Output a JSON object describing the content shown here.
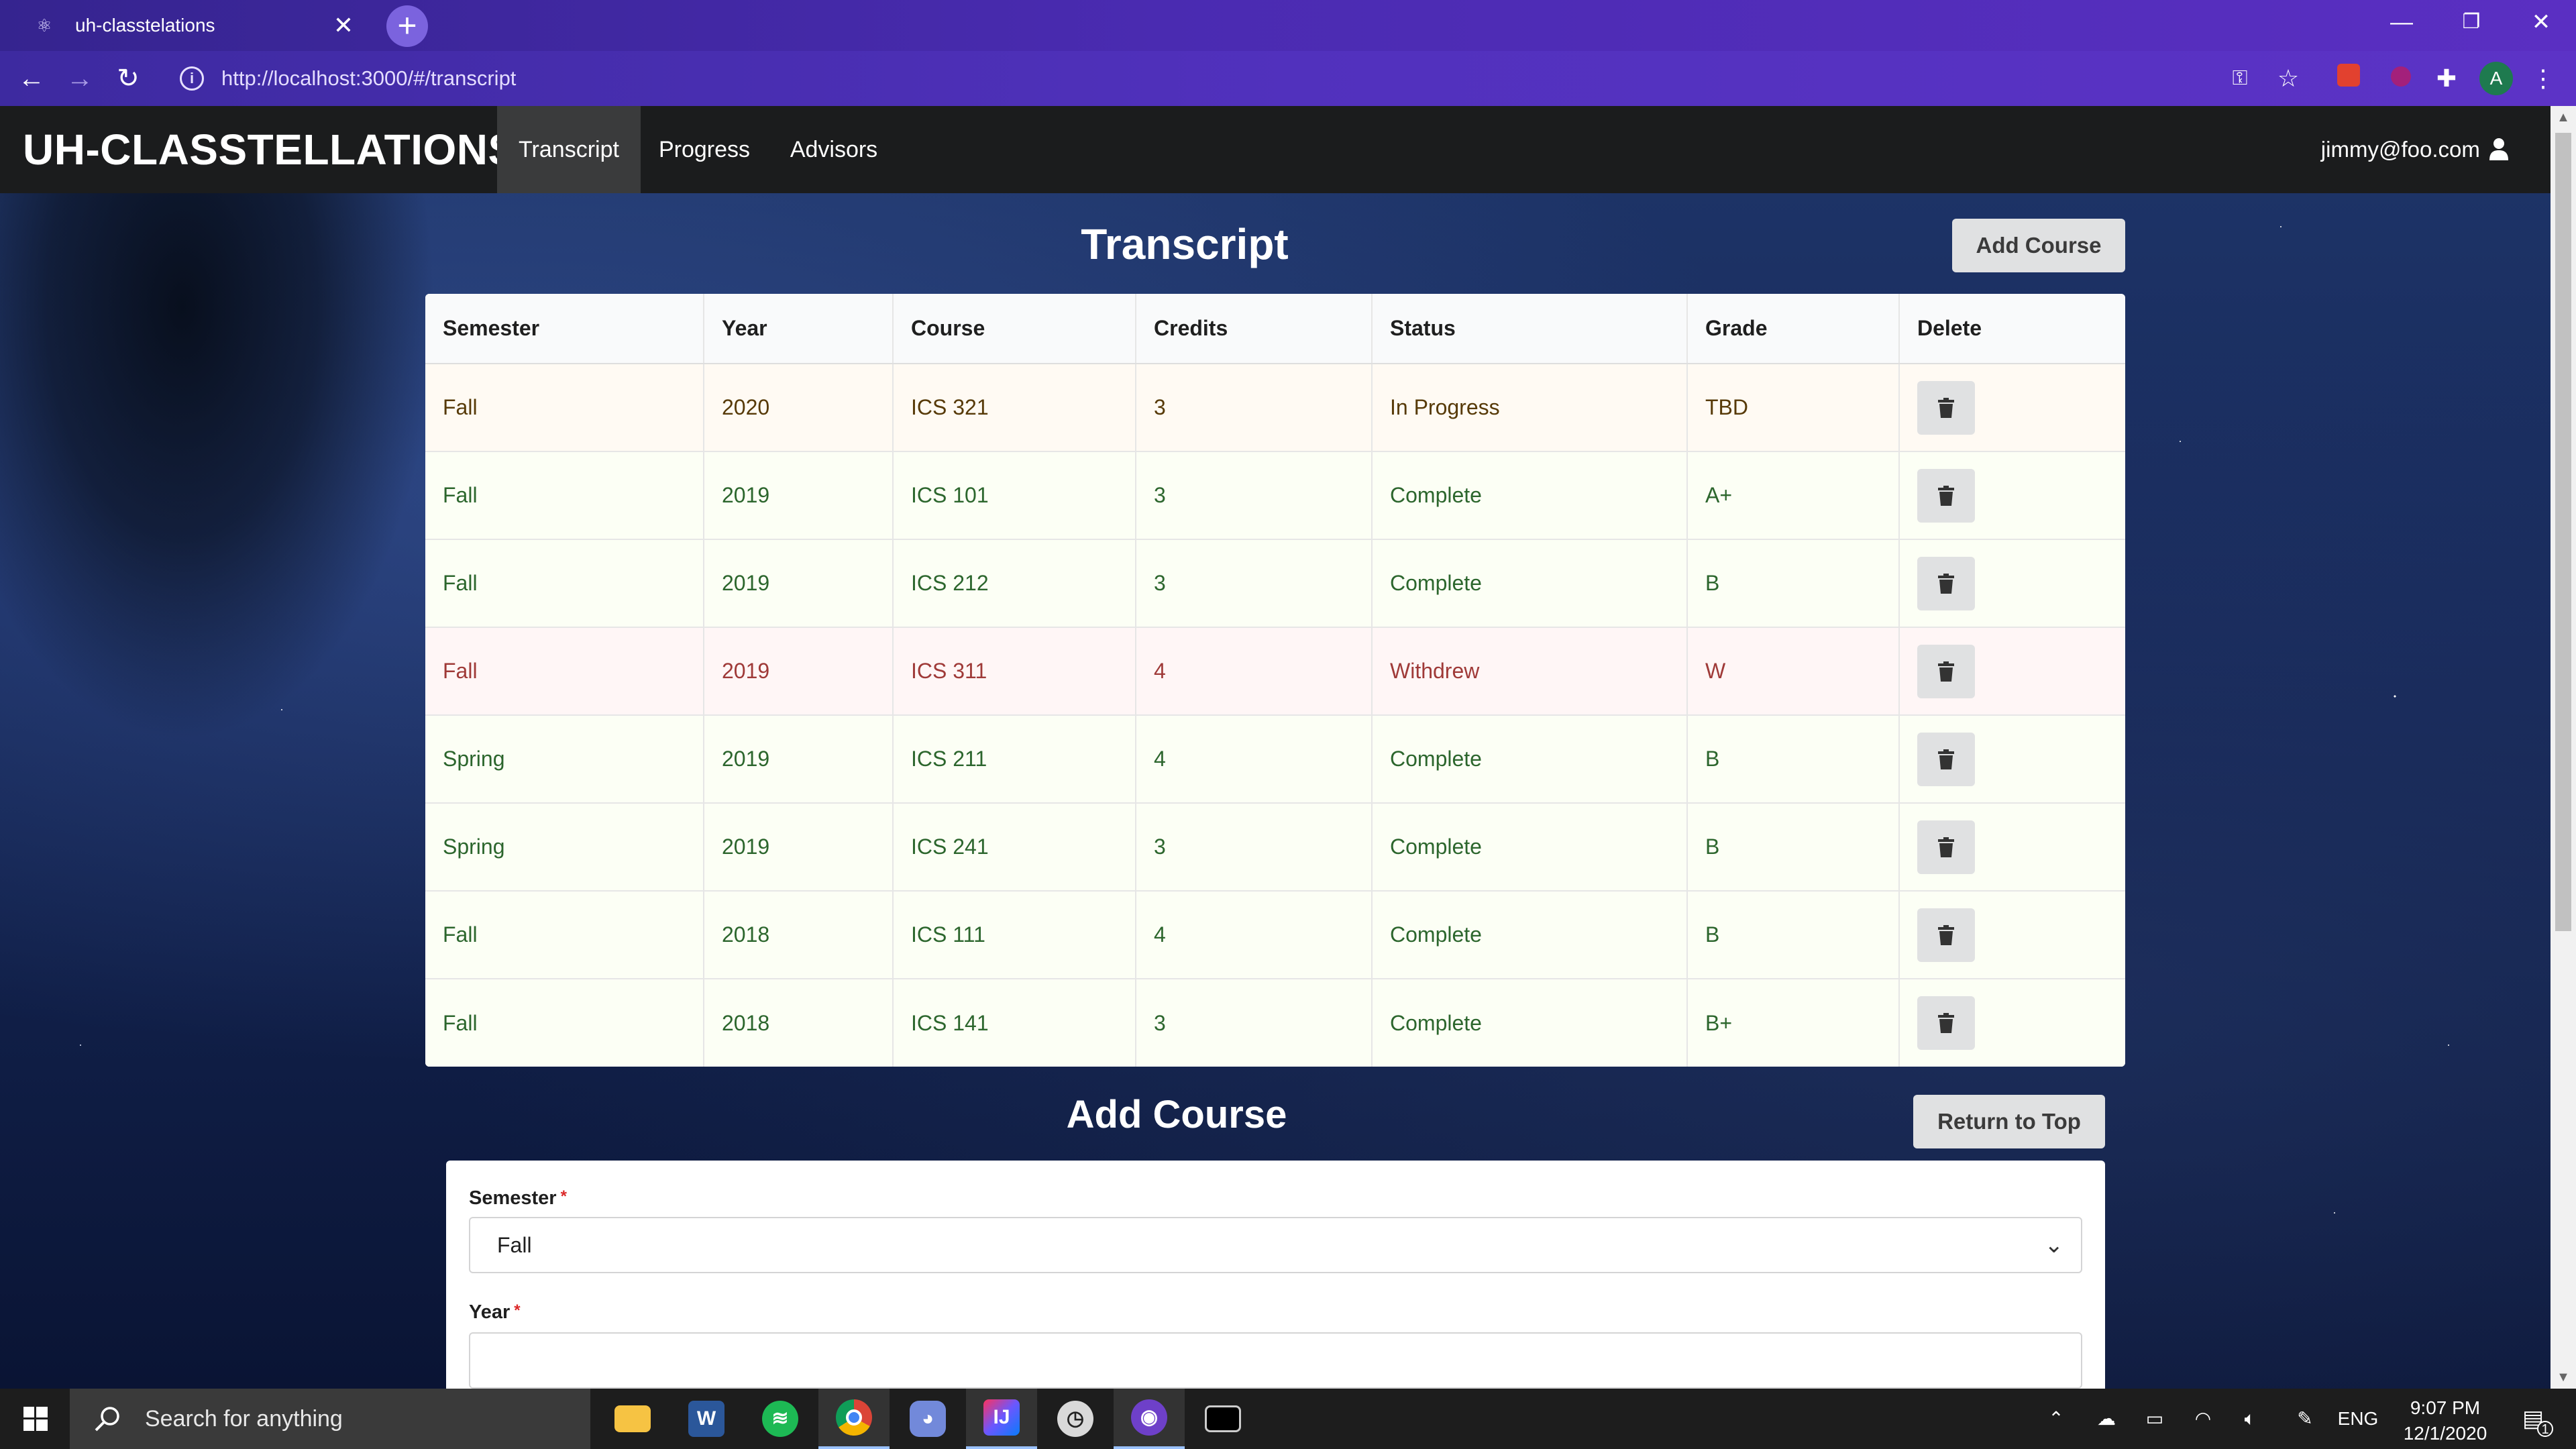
{
  "browser": {
    "tab_title": "uh-classtelations",
    "tab_close": "✕",
    "new_tab": "+",
    "url": "http://localhost:3000/#/transcript",
    "window_controls": {
      "minimize": "—",
      "restore": "❐",
      "close": "✕"
    },
    "nav": {
      "back": "←",
      "forward": "→",
      "reload": "↻"
    },
    "info_icon": "i",
    "profile_initial": "A"
  },
  "app": {
    "brand": "UH-CLASSTELLATIONS",
    "nav": [
      {
        "label": "Transcript",
        "active": true
      },
      {
        "label": "Progress",
        "active": false
      },
      {
        "label": "Advisors",
        "active": false
      }
    ],
    "user": "jimmy@foo.com"
  },
  "transcript": {
    "title": "Transcript",
    "add_course_button": "Add Course",
    "columns": [
      "Semester",
      "Year",
      "Course",
      "Credits",
      "Status",
      "Grade",
      "Delete"
    ],
    "rows": [
      {
        "semester": "Fall",
        "year": "2020",
        "course": "ICS 321",
        "credits": "3",
        "status": "In Progress",
        "grade": "TBD",
        "state": "warning"
      },
      {
        "semester": "Fall",
        "year": "2019",
        "course": "ICS 101",
        "credits": "3",
        "status": "Complete",
        "grade": "A+",
        "state": "positive"
      },
      {
        "semester": "Fall",
        "year": "2019",
        "course": "ICS 212",
        "credits": "3",
        "status": "Complete",
        "grade": "B",
        "state": "positive"
      },
      {
        "semester": "Fall",
        "year": "2019",
        "course": "ICS 311",
        "credits": "4",
        "status": "Withdrew",
        "grade": "W",
        "state": "negative"
      },
      {
        "semester": "Spring",
        "year": "2019",
        "course": "ICS 211",
        "credits": "4",
        "status": "Complete",
        "grade": "B",
        "state": "positive"
      },
      {
        "semester": "Spring",
        "year": "2019",
        "course": "ICS 241",
        "credits": "3",
        "status": "Complete",
        "grade": "B",
        "state": "positive"
      },
      {
        "semester": "Fall",
        "year": "2018",
        "course": "ICS 111",
        "credits": "4",
        "status": "Complete",
        "grade": "B",
        "state": "positive"
      },
      {
        "semester": "Fall",
        "year": "2018",
        "course": "ICS 141",
        "credits": "3",
        "status": "Complete",
        "grade": "B+",
        "state": "positive"
      }
    ]
  },
  "add_course_form": {
    "title": "Add Course",
    "return_button": "Return to Top",
    "semester_label": "Semester",
    "semester_value": "Fall",
    "year_label": "Year",
    "year_value": "",
    "required_mark": "*"
  },
  "taskbar": {
    "search_placeholder": "Search for anything",
    "language": "ENG",
    "time": "9:07 PM",
    "date": "12/1/2020",
    "notification_count": "1"
  },
  "colors": {
    "positive_text": "#2c662d",
    "warning_text": "#573a08",
    "negative_text": "#9f3a38",
    "nav_bg": "#1b1c1d",
    "chrome_accent": "#4a2bb1"
  }
}
